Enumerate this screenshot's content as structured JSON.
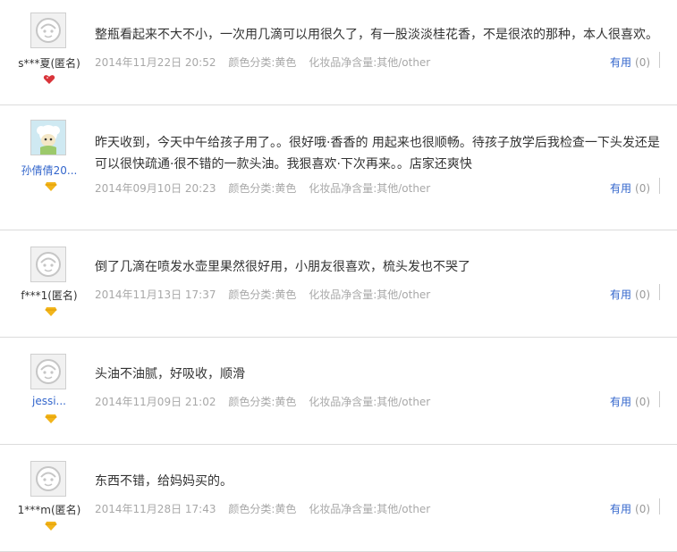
{
  "reviews": [
    {
      "user": "s***夏(匿名)",
      "badge_icon": "red-heart-badge-icon",
      "content": "整瓶看起来不大不小，一次用几滴可以用很久了，有一股淡淡桂花香，不是很浓的那种，本人很喜欢。",
      "date": "2014年11月22日 20:52",
      "color_category": "颜色分类:黄色",
      "net_content": "化妆品净含量:其他/other",
      "useful_label": "有用",
      "useful_count": "(0)"
    },
    {
      "user": "孙倩倩20...",
      "badge_icon": "gold-diamond-badge-icon",
      "content": "昨天收到，今天中午给孩子用了。。很好哦·香香的 用起来也很顺畅。待孩子放学后我检查一下头发还是可以很快疏通·很不错的一款头油。我狠喜欢·下次再来。。店家还爽快",
      "date": "2014年09月10日 20:23",
      "color_category": "颜色分类:黄色",
      "net_content": "化妆品净含量:其他/other",
      "useful_label": "有用",
      "useful_count": "(0)"
    },
    {
      "user": "f***1(匿名)",
      "badge_icon": "gold-diamond-badge-icon",
      "content": "倒了几滴在喷发水壶里果然很好用，小朋友很喜欢，梳头发也不哭了",
      "date": "2014年11月13日 17:37",
      "color_category": "颜色分类:黄色",
      "net_content": "化妆品净含量:其他/other",
      "useful_label": "有用",
      "useful_count": "(0)"
    },
    {
      "user": "jessi...",
      "badge_icon": "gold-diamond-badge-icon",
      "content": "头油不油腻，好吸收，顺滑",
      "date": "2014年11月09日 21:02",
      "color_category": "颜色分类:黄色",
      "net_content": "化妆品净含量:其他/other",
      "useful_label": "有用",
      "useful_count": "(0)"
    },
    {
      "user": "1***m(匿名)",
      "badge_icon": "gold-diamond-badge-icon",
      "content": "东西不错，给妈妈买的。",
      "date": "2014年11月28日 17:43",
      "color_category": "颜色分类:黄色",
      "net_content": "化妆品净含量:其他/other",
      "useful_label": "有用",
      "useful_count": "(0)"
    }
  ],
  "colors": {
    "link": "#3366cc",
    "meta": "#a8a8a8",
    "text": "#333333",
    "divider": "#dcdcdc",
    "badge_red": "#d9343a",
    "badge_gold": "#f2b51c"
  }
}
